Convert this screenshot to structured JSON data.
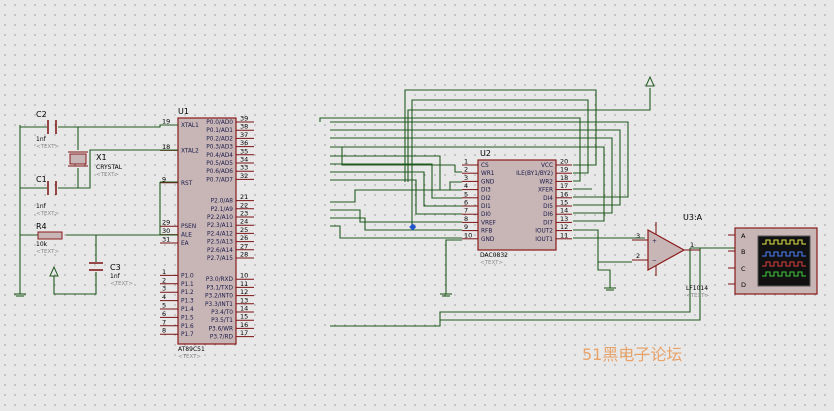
{
  "text_placeholder": "<TEXT>",
  "watermark": "51黑电子论坛",
  "colors": {
    "background": "#e8e8e8",
    "wire": "#1f5a1f",
    "chip": "#c8b6b6",
    "chip_border": "#8a1a1a",
    "watermark": "#e8a36a"
  },
  "u1": {
    "ref": "U1",
    "part": "AT89C51",
    "left_pins": [
      {
        "num": "19",
        "label": "XTAL1"
      },
      {
        "num": "18",
        "label": "XTAL2"
      },
      {
        "num": "9",
        "label": "RST"
      },
      {
        "num": "29",
        "label": "PSEN"
      },
      {
        "num": "30",
        "label": "ALE"
      },
      {
        "num": "31",
        "label": "EA"
      },
      {
        "num": "1",
        "label": "P1.0"
      },
      {
        "num": "2",
        "label": "P1.1"
      },
      {
        "num": "3",
        "label": "P1.2"
      },
      {
        "num": "4",
        "label": "P1.3"
      },
      {
        "num": "5",
        "label": "P1.4"
      },
      {
        "num": "6",
        "label": "P1.5"
      },
      {
        "num": "7",
        "label": "P1.6"
      },
      {
        "num": "8",
        "label": "P1.7"
      }
    ],
    "right_pins": [
      {
        "num": "39",
        "label": "P0.0/AD0"
      },
      {
        "num": "38",
        "label": "P0.1/AD1"
      },
      {
        "num": "37",
        "label": "P0.2/AD2"
      },
      {
        "num": "36",
        "label": "P0.3/AD3"
      },
      {
        "num": "35",
        "label": "P0.4/AD4"
      },
      {
        "num": "34",
        "label": "P0.5/AD5"
      },
      {
        "num": "33",
        "label": "P0.6/AD6"
      },
      {
        "num": "32",
        "label": "P0.7/AD7"
      },
      {
        "num": "21",
        "label": "P2.0/A8"
      },
      {
        "num": "22",
        "label": "P2.1/A9"
      },
      {
        "num": "23",
        "label": "P2.2/A10"
      },
      {
        "num": "24",
        "label": "P2.3/A11"
      },
      {
        "num": "25",
        "label": "P2.4/A12"
      },
      {
        "num": "26",
        "label": "P2.5/A13"
      },
      {
        "num": "27",
        "label": "P2.6/A14"
      },
      {
        "num": "28",
        "label": "P2.7/A15"
      },
      {
        "num": "10",
        "label": "P3.0/RXD"
      },
      {
        "num": "11",
        "label": "P3.1/TXD"
      },
      {
        "num": "12",
        "label": "P3.2/INT0"
      },
      {
        "num": "13",
        "label": "P3.3/INT1"
      },
      {
        "num": "14",
        "label": "P3.4/T0"
      },
      {
        "num": "15",
        "label": "P3.5/T1"
      },
      {
        "num": "16",
        "label": "P3.6/WR"
      },
      {
        "num": "17",
        "label": "P3.7/RD"
      }
    ]
  },
  "u2": {
    "ref": "U2",
    "part": "DAC0832",
    "left_pins": [
      {
        "num": "1",
        "label": "CS"
      },
      {
        "num": "2",
        "label": "WR1"
      },
      {
        "num": "3",
        "label": "GND"
      },
      {
        "num": "4",
        "label": "DI3"
      },
      {
        "num": "5",
        "label": "DI2"
      },
      {
        "num": "6",
        "label": "DI1"
      },
      {
        "num": "7",
        "label": "DI0"
      },
      {
        "num": "8",
        "label": "VREF"
      },
      {
        "num": "9",
        "label": "RFB"
      },
      {
        "num": "10",
        "label": "GND"
      }
    ],
    "right_pins": [
      {
        "num": "20",
        "label": "VCC"
      },
      {
        "num": "19",
        "label": "ILE(BY1/BY2)"
      },
      {
        "num": "18",
        "label": "WR2"
      },
      {
        "num": "17",
        "label": "XFER"
      },
      {
        "num": "16",
        "label": "DI4"
      },
      {
        "num": "15",
        "label": "DI5"
      },
      {
        "num": "14",
        "label": "DI6"
      },
      {
        "num": "13",
        "label": "DI7"
      },
      {
        "num": "12",
        "label": "IOUT2"
      },
      {
        "num": "11",
        "label": "IOUT1"
      }
    ]
  },
  "u3": {
    "ref": "U3:A",
    "part": "LF1014",
    "pins": [
      "3",
      "2",
      "1"
    ]
  },
  "c1": {
    "ref": "C1",
    "value": "1nf"
  },
  "c2": {
    "ref": "C2",
    "value": "1nf"
  },
  "c3": {
    "ref": "C3",
    "value": "1nf"
  },
  "x1": {
    "ref": "X1",
    "value": "CRYSTAL"
  },
  "r4": {
    "ref": "R4",
    "value": "10k"
  },
  "scope": {
    "channels": [
      "A",
      "B",
      "C",
      "D"
    ]
  }
}
